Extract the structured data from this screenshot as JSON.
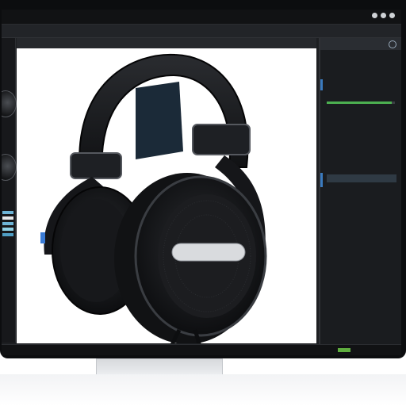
{
  "window": {
    "title": ""
  },
  "menu": {
    "items": [
      "",
      "",
      "",
      "",
      ""
    ]
  },
  "canvas": {
    "header": ""
  },
  "right_panel": {
    "title": "",
    "rows": [
      "",
      "",
      "",
      "",
      "",
      "",
      "",
      "",
      "",
      "",
      "",
      "",
      "",
      "",
      "",
      ""
    ],
    "slider_fraction": 0.95
  },
  "status": {
    "left": "",
    "right": ""
  },
  "colors": {
    "accent": "#3b7bbf",
    "green": "#5fae3f",
    "bezel": "#0c0d0f"
  },
  "photo": {
    "badge_text": ""
  }
}
